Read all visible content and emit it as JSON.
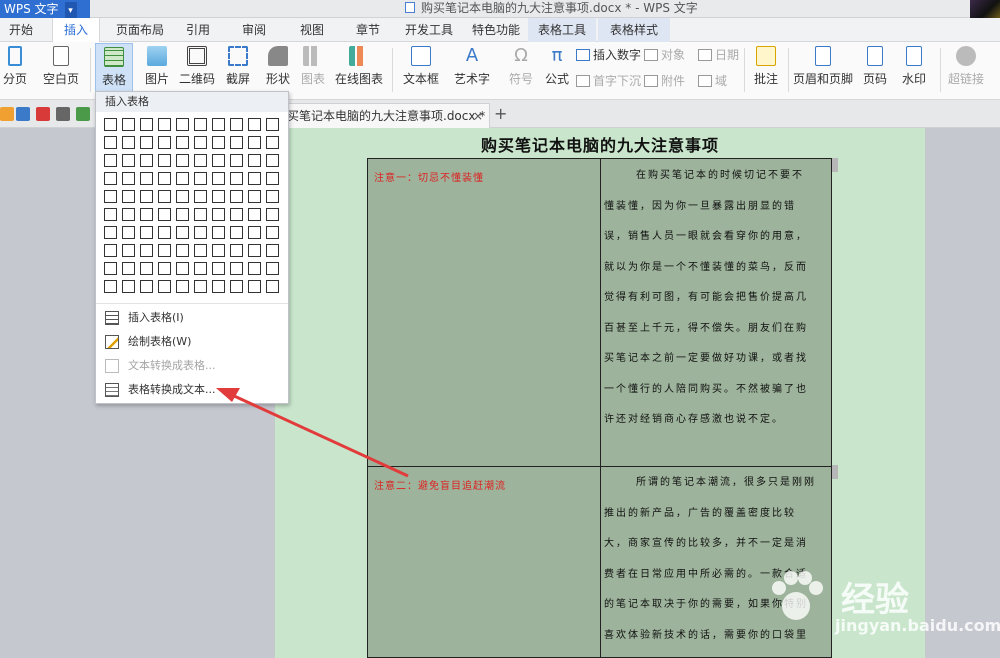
{
  "titlebar": {
    "app_name": "WPS 文字",
    "app_arrow": "▾",
    "doc_title": "购买笔记本电脑的九大注意事项.docx * - WPS 文字"
  },
  "tabs": [
    "开始",
    "插入",
    "页面布局",
    "引用",
    "审阅",
    "视图",
    "章节",
    "开发工具",
    "特色功能",
    "表格工具",
    "表格样式"
  ],
  "ribbon": {
    "page_break": "分页",
    "blank_page": "空白页",
    "table": "表格",
    "picture": "图片",
    "qrcode": "二维码",
    "screenshot": "截屏",
    "shapes": "形状",
    "chart": "图表",
    "online_chart": "在线图表",
    "textbox": "文本框",
    "wordart": "艺术字",
    "symbol": "符号",
    "formula": "公式",
    "insert_number": "插入数字",
    "object": "对象",
    "date": "日期",
    "drop_cap": "首字下沉",
    "attachment": "附件",
    "field": "域",
    "comment": "批注",
    "header_footer": "页眉和页脚",
    "page_number": "页码",
    "watermark": "水印",
    "hyperlink": "超链接"
  },
  "doc_tab": {
    "label": "买笔记本电脑的九大注意事项.docx *",
    "close": "×",
    "add": "+"
  },
  "dropdown": {
    "header": "插入表格",
    "items": [
      {
        "label": "插入表格(I)",
        "enabled": true
      },
      {
        "label": "绘制表格(W)",
        "enabled": true
      },
      {
        "label": "文本转换成表格...",
        "enabled": false
      },
      {
        "label": "表格转换成文本...",
        "enabled": true
      }
    ],
    "grid_cols": 10,
    "grid_rows": 10
  },
  "document": {
    "heading": "购买笔记本电脑的九大注意事项",
    "note1": "注意一：切忌不懂装懂",
    "para1": [
      "在购买笔记本的时候切记不要不",
      "懂装懂，因为你一旦暴露出朋显的错",
      "误，销售人员一眼就会看穿你的用意，",
      "就以为你是一个不懂装懂的菜鸟，反而",
      "觉得有利可图，有可能会把售价提高几",
      "百甚至上千元，得不偿失。朋友们在购",
      "买笔记本之前一定要做好功课，或者找",
      "一个懂行的人陪同购买。不然被骗了也",
      "许还对经销商心存感激也说不定。"
    ],
    "note2": "注意二：避免盲目追赶潮流",
    "para2": [
      "所谓的笔记本潮流，很多只是刚刚",
      "推出的新产品，广告的覆盖密度比较",
      "大，商家宣传的比较多，并不一定是消",
      "费者在日常应用中所必需的。一款合适",
      "的笔记本取决于你的需要，如果你特别",
      "喜欢体验新技术的话，需要你的口袋里"
    ]
  },
  "watermark": {
    "brand": "经验",
    "url": "jingyan.baidu.com"
  },
  "colors": {
    "accent": "#2b6fd6",
    "page": "#c9e6cc",
    "table": "#9db39b",
    "note": "#dd2222",
    "arrow": "#e23b3b"
  }
}
